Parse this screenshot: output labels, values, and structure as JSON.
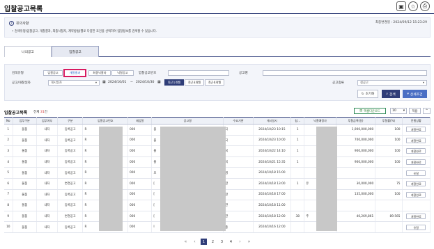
{
  "page": {
    "title": "입찰공고목록"
  },
  "header_icons": [
    "bookmark-icon",
    "star-icon",
    "print-icon"
  ],
  "notice": {
    "title": "유의사항",
    "body": "• 검색유형(입찰공고, 개찰결과, 최종낙찰자, 계약방법)별로 다양한 조건을 선택하여 입찰정보를 검색할 수 있습니다.",
    "last_changed": "최종변경일 : 2024/09/12 15:23:29"
  },
  "tabs": [
    {
      "label": "나의공고"
    },
    {
      "label": "입찰공고"
    }
  ],
  "search": {
    "type_label": "검색유형",
    "type_chips": [
      "입찰공고",
      "개찰결과",
      "최종낙찰자",
      "낙찰공고"
    ],
    "notice_no_label": "입찰공고번호",
    "notice_name_label": "공고명",
    "date_label": "공고/개찰일자",
    "date_type": "게시일자",
    "date_from": "2024/10/01",
    "date_to": "2024/10/30",
    "range_sep": "~",
    "range_buttons": [
      "최근1개월",
      "최근3개월",
      "최근6개월"
    ],
    "category_label": "공고종류",
    "category_value": "실공고",
    "reset_label": "초기화",
    "search_label": "검색",
    "detail_label": "상세조건"
  },
  "list": {
    "title": "입찰공고목록",
    "total_prefix": "전체 ",
    "total_count": "31",
    "total_suffix": "건",
    "excel_label": "엑셀다운로드",
    "page_size": "10",
    "apply_label": "적용",
    "collapse_symbol": "^"
  },
  "table": {
    "columns": [
      "No",
      "업무구분",
      "업무여부",
      "구분",
      "입찰공고번호",
      "재입찰",
      "공고명",
      "수요기관",
      "게시일시",
      "참...",
      "낙찰예정자",
      "투찰금액(원)",
      "투찰률(%)",
      "진행상황"
    ],
    "rows": [
      {
        "no": "1",
        "biz": "물품",
        "kind": "내자",
        "div": "등록공고",
        "no_prefix": "R",
        "re": "000",
        "name": "물",
        "org": "국",
        "date": "2024/10/23 10:15",
        "cnt": "1",
        "winner": "",
        "amount": "1,900,000,000",
        "rate": "100",
        "status": "개찰완료"
      },
      {
        "no": "2",
        "biz": "물품",
        "kind": "내자",
        "div": "등록공고",
        "no_prefix": "R",
        "re": "000",
        "name": "물",
        "org": "국",
        "date": "2024/10/23 10:00",
        "cnt": "1",
        "winner": "",
        "amount": "700,000,000",
        "rate": "100",
        "status": "개찰완료"
      },
      {
        "no": "3",
        "biz": "물품",
        "kind": "내자",
        "div": "등록공고",
        "no_prefix": "R",
        "re": "000",
        "name": "물",
        "org": "국",
        "date": "2024/10/22 14:10",
        "cnt": "1",
        "winner": "",
        "amount": "900,000,000",
        "rate": "100",
        "status": "개찰완료"
      },
      {
        "no": "4",
        "biz": "물품",
        "kind": "내자",
        "div": "등록공고",
        "no_prefix": "R",
        "re": "000",
        "name": "물",
        "org": "국",
        "date": "2024/10/21 15:35",
        "cnt": "1",
        "winner": "",
        "amount": "900,000,000",
        "rate": "100",
        "status": "개찰완료"
      },
      {
        "no": "5",
        "biz": "물품",
        "kind": "내자",
        "div": "등록공고",
        "no_prefix": "R",
        "re": "000",
        "name": "모",
        "org": "경",
        "date": "2024/10/18 15:00",
        "cnt": "",
        "winner": "",
        "amount": "",
        "rate": "",
        "status": "유찰"
      },
      {
        "no": "6",
        "biz": "물품",
        "kind": "내자",
        "div": "변경공고",
        "no_prefix": "R",
        "re": "000",
        "name": "[",
        "org": "한",
        "date": "2024/10/18 13:00",
        "cnt": "1",
        "winner": "유",
        "amount": "30,000,000",
        "rate": "75",
        "status": "개찰완료"
      },
      {
        "no": "7",
        "biz": "물품",
        "kind": "내자",
        "div": "등록공고",
        "no_prefix": "R",
        "re": "000",
        "name": "[",
        "org": "한",
        "date": "2024/10/18 17:00",
        "cnt": "",
        "winner": "",
        "amount": "135,000,000",
        "rate": "100",
        "status": "개찰완료"
      },
      {
        "no": "8",
        "biz": "물품",
        "kind": "내자",
        "div": "등록공고",
        "no_prefix": "R",
        "re": "000",
        "name": "[",
        "org": "한",
        "date": "2024/10/18 11:00",
        "cnt": "",
        "winner": "",
        "amount": "",
        "rate": "",
        "status": ""
      },
      {
        "no": "9",
        "biz": "물품",
        "kind": "내자",
        "div": "변경공고",
        "no_prefix": "R",
        "re": "000",
        "name": "[",
        "org": "한",
        "date": "2024/10/18 12:00",
        "cnt": "38",
        "winner": "주",
        "amount": "40,269,861",
        "rate": "89.565",
        "status": "개찰완료"
      },
      {
        "no": "10",
        "biz": "물품",
        "kind": "내자",
        "div": "등록공고",
        "no_prefix": "R",
        "re": "000",
        "name": "I",
        "org": "충",
        "date": "2024/10/16 12:00",
        "cnt": "",
        "winner": "",
        "amount": "",
        "rate": "",
        "status": "유찰"
      }
    ]
  },
  "pagination": {
    "first": "«",
    "prev": "‹",
    "pages": [
      "1",
      "2",
      "3",
      "4"
    ],
    "current": "1",
    "next": "›",
    "last": "»"
  },
  "colors": {
    "primary": "#2f3d78",
    "highlight": "#d81b60",
    "count": "#d32f2f",
    "excel": "#2e7d32"
  }
}
